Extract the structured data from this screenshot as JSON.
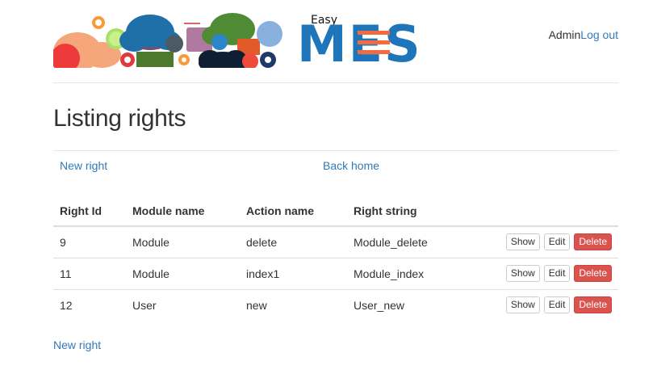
{
  "header": {
    "logo_small_text": "Easy",
    "logo_main_text": "MES",
    "user_name": "Admin",
    "logout_label": "Log out"
  },
  "page": {
    "title": "Listing rights",
    "new_right_label": "New right",
    "back_home_label": "Back home",
    "bottom_new_right_label": "New right"
  },
  "table": {
    "headers": [
      "Right Id",
      "Module name",
      "Action name",
      "Right string"
    ],
    "rows": [
      {
        "id": "9",
        "module": "Module",
        "action": "delete",
        "right_string": "Module_delete"
      },
      {
        "id": "11",
        "module": "Module",
        "action": "index1",
        "right_string": "Module_index"
      },
      {
        "id": "12",
        "module": "User",
        "action": "new",
        "right_string": "User_new"
      }
    ],
    "show_label": "Show",
    "edit_label": "Edit",
    "delete_label": "Delete"
  },
  "colors": {
    "link": "#337ab7",
    "danger": "#d9534f",
    "logo_blue": "#1f75b9",
    "logo_orange": "#f26a3d"
  }
}
